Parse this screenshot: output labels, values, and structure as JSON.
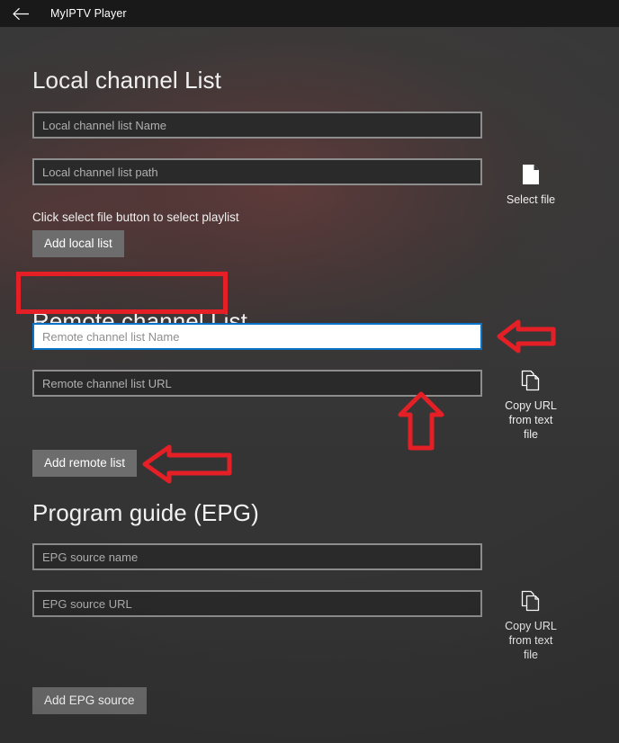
{
  "window": {
    "title": "MyIPTV Player",
    "back_icon": "back-arrow-icon"
  },
  "theme": {
    "accent_focus_border": "#0a72c4",
    "annotation_red": "#e51f26",
    "field_bg": "#2a2a2a",
    "field_border": "#8d8d8d",
    "button_bg": "#6d6d6d",
    "page_bg": "#343434",
    "titlebar_bg": "#191919"
  },
  "sections": {
    "local": {
      "heading": "Local channel List",
      "name_field": {
        "value": "",
        "placeholder": "Local channel list Name"
      },
      "path_field": {
        "value": "",
        "placeholder": "Local channel list path"
      },
      "hint": "Click select file button to select playlist",
      "add_button": "Add local list",
      "select_file": {
        "label": "Select file",
        "icon": "document-page-icon"
      }
    },
    "remote": {
      "heading": "Remote channel List",
      "name_field": {
        "value": "",
        "placeholder": "Remote channel list Name",
        "focused": true
      },
      "url_field": {
        "value": "",
        "placeholder": "Remote channel list URL"
      },
      "add_button": "Add remote list",
      "copy_url": {
        "label": "Copy URL\nfrom text\nfile",
        "icon": "copy-pages-icon"
      }
    },
    "epg": {
      "heading": "Program guide (EPG)",
      "name_field": {
        "value": "",
        "placeholder": "EPG source name"
      },
      "url_field": {
        "value": "",
        "placeholder": "EPG source URL"
      },
      "add_button": "Add EPG source",
      "copy_url": {
        "label": "Copy URL\nfrom text\nfile",
        "icon": "copy-pages-icon"
      }
    }
  },
  "annotations": [
    {
      "name": "highlight-remote-channel-list-heading",
      "shape": "rectangle"
    },
    {
      "name": "arrow-to-remote-name-field",
      "shape": "arrow-left"
    },
    {
      "name": "arrow-to-remote-url-field",
      "shape": "arrow-up"
    },
    {
      "name": "arrow-to-add-remote-list-button",
      "shape": "arrow-left"
    }
  ]
}
